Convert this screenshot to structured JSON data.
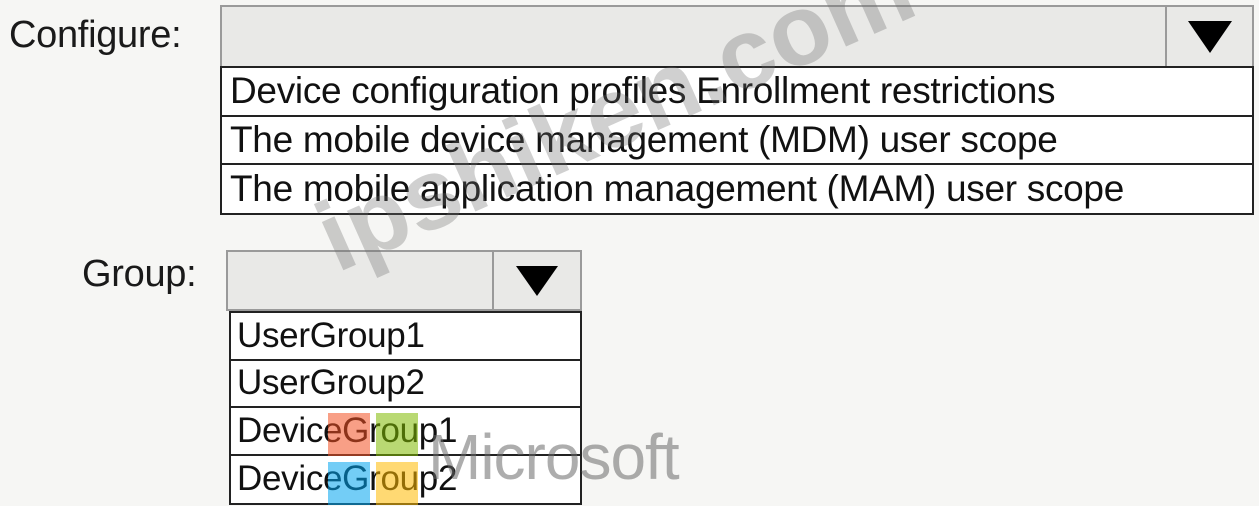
{
  "configure": {
    "label": "Configure:",
    "selected_value": "",
    "options": [
      "Device configuration profiles Enrollment restrictions",
      "The mobile device management (MDM) user scope",
      "The mobile application management (MAM) user scope"
    ]
  },
  "group": {
    "label": "Group:",
    "selected_value": "",
    "options": [
      "UserGroup1",
      "UserGroup2",
      "DeviceGroup1",
      "DeviceGroup2"
    ]
  },
  "watermark": {
    "site_text": "ipshiken.com",
    "brand_text": "Microsoft",
    "logo_colors": [
      "#f25022",
      "#7fba00",
      "#00a4ef",
      "#ffb900"
    ]
  },
  "icons": {
    "dropdown": "triangle-down-icon"
  },
  "colors": {
    "select_fill": "#e9e9e7",
    "list_border": "#222222",
    "arrow": "#000000"
  }
}
